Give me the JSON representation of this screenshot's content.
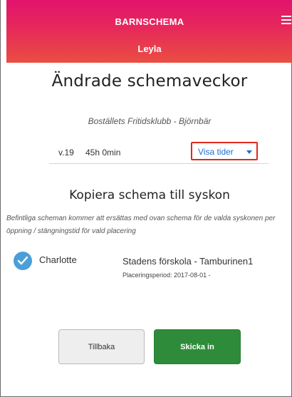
{
  "header": {
    "app_title": "BARNSCHEMA",
    "child_name": "Leyla",
    "gradient_colors": [
      "#e2136d",
      "#ea4e42"
    ]
  },
  "page_title": "Ändrade schemaveckor",
  "placement_name": "Boställets Fritidsklubb - Björnbär",
  "week": {
    "label": "v.19",
    "hours": "45h 0min",
    "show_times_label": "Visa tider"
  },
  "copy_section": {
    "title": "Kopiera schema till syskon",
    "info": "Befintliga scheman kommer att ersättas med ovan schema för de valda syskonen per öppning / stängningstid för vald placering"
  },
  "siblings": [
    {
      "name": "Charlotte",
      "checked": true,
      "school": "Stadens förskola - Tamburinen1",
      "period": "Placeringsperiod: 2017-08-01 -"
    }
  ],
  "buttons": {
    "back_label": "Tillbaka",
    "submit_label": "Skicka in"
  },
  "colors": {
    "accent_blue": "#1a6fd6",
    "highlight_red": "#e0281c",
    "submit_green": "#2e8b3a",
    "check_blue": "#4a9fd8"
  }
}
